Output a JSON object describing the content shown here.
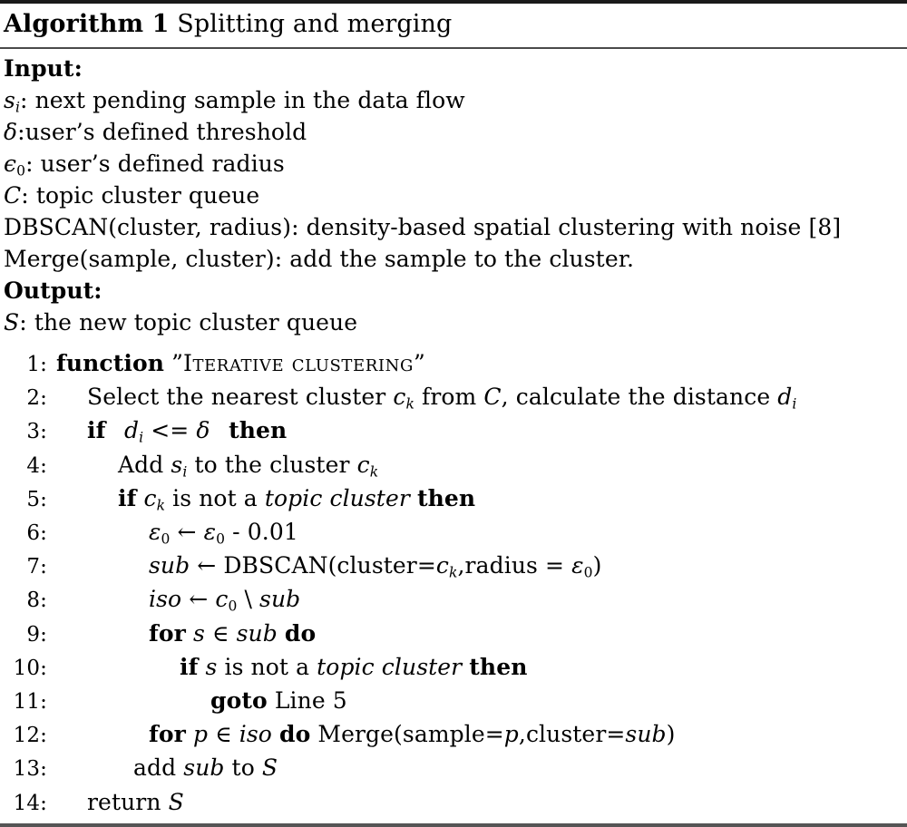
{
  "algorithm": {
    "label": "Algorithm 1",
    "caption": "Splitting and merging",
    "input_heading": "Input:",
    "output_heading": "Output:",
    "inputs": [
      {
        "symbol": "s",
        "symbol_sub": "i",
        "separator": ": ",
        "text": "next pending sample in the data flow"
      },
      {
        "symbol": "δ",
        "symbol_sub": "",
        "separator": ":",
        "text": "user’s defined threshold"
      },
      {
        "symbol": "ϵ",
        "symbol_sub": "0",
        "separator": ": ",
        "text": "user’s defined radius"
      },
      {
        "symbol": "C",
        "symbol_sub": "",
        "separator": ": ",
        "text": "topic cluster queue"
      },
      {
        "symbol": "DBSCAN(cluster, radius)",
        "symbol_sub": "",
        "separator": ": ",
        "text": "density-based spatial clustering with noise [8]"
      },
      {
        "symbol": "Merge(sample, cluster)",
        "symbol_sub": "",
        "separator": ": ",
        "text": "add the sample to the cluster."
      }
    ],
    "outputs": [
      {
        "symbol": "S",
        "symbol_sub": "",
        "separator": ": ",
        "text": "the new topic cluster queue"
      }
    ],
    "lines": [
      {
        "no": "1:",
        "indent": 0,
        "text": "function ”Iterative clustering”"
      },
      {
        "no": "2:",
        "indent": 1,
        "text": "Select the nearest cluster cₖ from C, calculate the distance dᵢ"
      },
      {
        "no": "3:",
        "indent": 1,
        "text": "if  dᵢ <= δ  then"
      },
      {
        "no": "4:",
        "indent": 2,
        "text": "Add sᵢ to the cluster cₖ"
      },
      {
        "no": "5:",
        "indent": 2,
        "text": "if cₖ is not a topic cluster then"
      },
      {
        "no": "6:",
        "indent": 3,
        "text": "ϵ₀ ← ϵ₀ - 0.01"
      },
      {
        "no": "7:",
        "indent": 3,
        "text": "sub ← DBSCAN(cluster=cₖ,radius = ϵ₀)"
      },
      {
        "no": "8:",
        "indent": 3,
        "text": "iso ← c₀ \\ sub"
      },
      {
        "no": "9:",
        "indent": 3,
        "text": "for s ∈ sub do"
      },
      {
        "no": "10:",
        "indent": 4,
        "text": "if s is not a topic cluster then"
      },
      {
        "no": "11:",
        "indent": 5,
        "text": "goto Line 5"
      },
      {
        "no": "12:",
        "indent": 3,
        "text": "for p ∈ iso do Merge(sample=p,cluster=sub)"
      },
      {
        "no": "13:",
        "indent": 2.5,
        "text": "add sub to S"
      },
      {
        "no": "14:",
        "indent": 1,
        "text": "return S"
      }
    ]
  }
}
